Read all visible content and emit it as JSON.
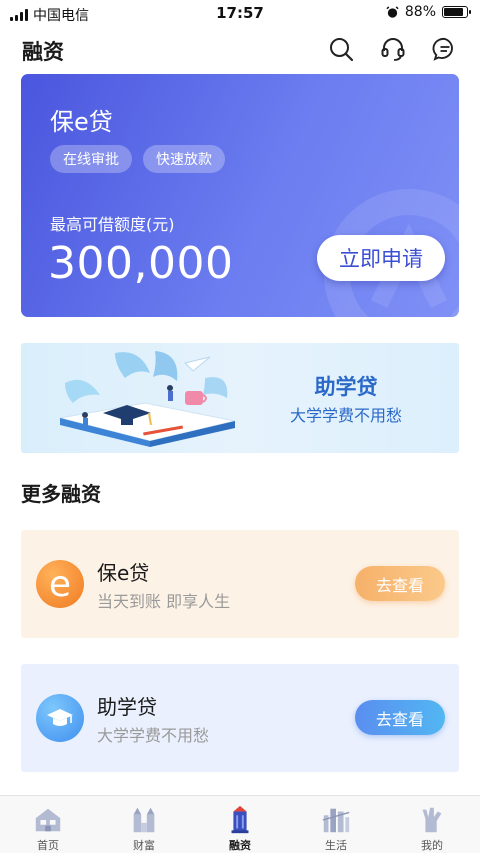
{
  "status_bar": {
    "carrier": "中国电信",
    "time": "17:57",
    "battery": "88%",
    "battery_level": 0.88
  },
  "header": {
    "title": "融资",
    "icons": [
      "search-icon",
      "headset-icon",
      "message-icon"
    ]
  },
  "hero": {
    "title": "保e贷",
    "tags": [
      "在线审批",
      "快速放款"
    ],
    "limit_label": "最高可借额度(元)",
    "amount": "300,000",
    "apply_label": "立即申请"
  },
  "banner": {
    "title": "助学贷",
    "subtitle": "大学学费不用愁"
  },
  "more_section": {
    "title": "更多融资"
  },
  "products": [
    {
      "icon_text": "e",
      "icon": "e-letter-icon",
      "name": "保e贷",
      "desc": "当天到账 即享人生",
      "button": "去查看",
      "accent": "#f6b16a"
    },
    {
      "icon": "graduation-cap-icon",
      "name": "助学贷",
      "desc": "大学学费不用愁",
      "button": "去查看",
      "accent": "#5a8ef0"
    }
  ],
  "tabbar": {
    "items": [
      {
        "label": "首页",
        "icon": "home-icon"
      },
      {
        "label": "财富",
        "icon": "wealth-icon"
      },
      {
        "label": "融资",
        "icon": "finance-icon",
        "active": true
      },
      {
        "label": "生活",
        "icon": "life-icon"
      },
      {
        "label": "我的",
        "icon": "profile-icon"
      }
    ]
  },
  "colors": {
    "hero_start": "#4a56de",
    "hero_end": "#7f90f6",
    "banner_text": "#2a69c8",
    "tab_icon": "#b3bbd3",
    "tab_icon_active": "#3a4fbf"
  }
}
